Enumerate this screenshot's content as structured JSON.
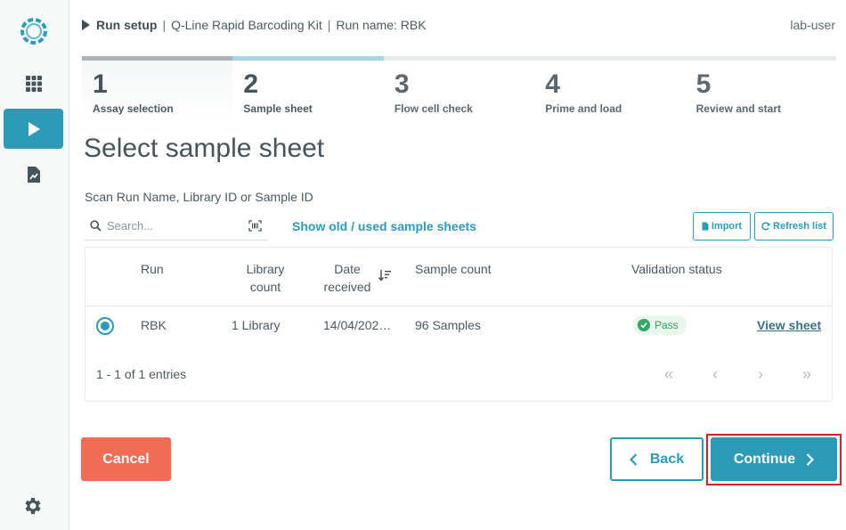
{
  "header": {
    "section": "Run setup",
    "kit": "Q-Line Rapid Barcoding Kit",
    "run_name": "Run name: RBK",
    "separator": "|",
    "user": "lab-user"
  },
  "stepper": {
    "steps": [
      {
        "num": "1",
        "label": "Assay selection",
        "state": "done"
      },
      {
        "num": "2",
        "label": "Sample sheet",
        "state": "current"
      },
      {
        "num": "3",
        "label": "Flow cell check",
        "state": "future"
      },
      {
        "num": "4",
        "label": "Prime and load",
        "state": "future"
      },
      {
        "num": "5",
        "label": "Review and start",
        "state": "future"
      }
    ]
  },
  "page": {
    "title": "Select sample sheet",
    "scan_label": "Scan Run Name, Library ID or Sample ID"
  },
  "search": {
    "placeholder": "Search...",
    "value": ""
  },
  "toolbar": {
    "show_old": "Show old / used sample sheets",
    "import": "Import",
    "refresh": "Refresh list"
  },
  "table": {
    "headers": {
      "run": "Run",
      "library_count_1": "Library",
      "library_count_2": "count",
      "date_1": "Date",
      "date_2": "received",
      "sample_count": "Sample count",
      "validation": "Validation status"
    },
    "rows": [
      {
        "run": "RBK",
        "library_count": "1 Library",
        "date": "14/04/202…",
        "sample_count": "96 Samples",
        "validation": "Pass",
        "action": "View sheet"
      }
    ],
    "pager_info": "1 - 1 of 1 entries"
  },
  "footer": {
    "cancel": "Cancel",
    "back": "Back",
    "continue": "Continue"
  },
  "colors": {
    "accent": "#2b9bb8",
    "danger": "#f16b55",
    "success": "#33a866",
    "highlight": "#e02020"
  },
  "icons": {
    "logo": "nanopore-swirl-logo-icon",
    "apps": "grid-apps-icon",
    "run": "play-icon",
    "reports": "report-chart-icon",
    "settings": "gear-icon"
  }
}
